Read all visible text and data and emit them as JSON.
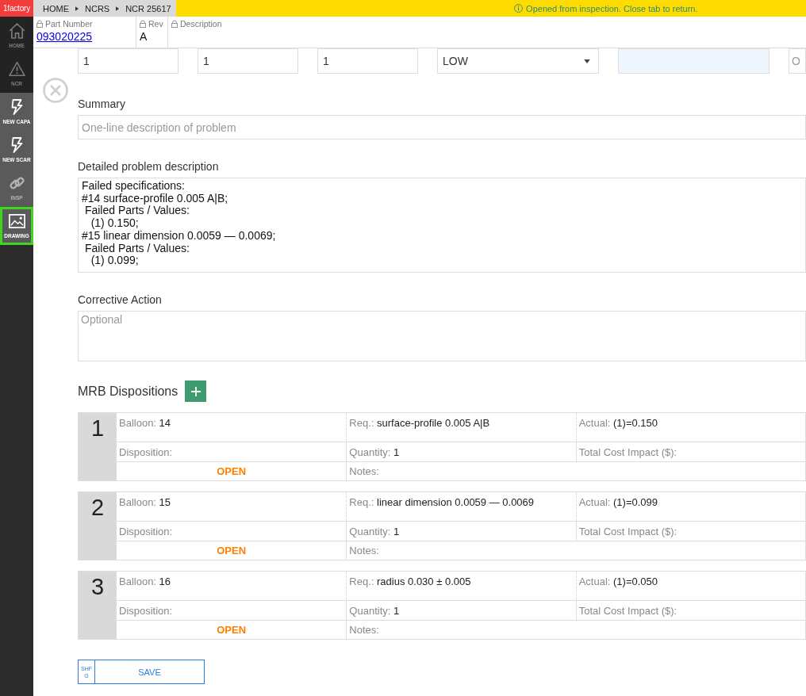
{
  "sidebar": {
    "logo": "1factory",
    "items": [
      {
        "label": "HOME",
        "kind": "nav",
        "disabled": true,
        "selected": false
      },
      {
        "label": "NCR",
        "kind": "nav",
        "disabled": true,
        "selected": false
      },
      {
        "label": "NEW CAPA",
        "kind": "action",
        "disabled": false,
        "selected": false
      },
      {
        "label": "NEW SCAR",
        "kind": "action",
        "disabled": false,
        "selected": false
      },
      {
        "label": "INSP",
        "kind": "action",
        "disabled": true,
        "selected": false
      },
      {
        "label": "DRAWING",
        "kind": "action",
        "disabled": false,
        "selected": true
      }
    ]
  },
  "breadcrumb": [
    "HOME",
    "NCRS",
    "NCR 25617"
  ],
  "notice": {
    "text": "Opened from inspection. Close tab to return."
  },
  "header_fields": [
    {
      "label": "Part Number",
      "value": "093020225",
      "kind": "link",
      "locked": true
    },
    {
      "label": "Rev",
      "value": "A",
      "kind": "text",
      "locked": true
    },
    {
      "label": "Description",
      "locked": true
    }
  ],
  "top_fields": [
    {
      "kind": "input",
      "value": "1"
    },
    {
      "kind": "input",
      "value": "1"
    },
    {
      "kind": "input",
      "value": "1"
    },
    {
      "kind": "select",
      "value": "LOW"
    },
    {
      "kind": "readonly"
    },
    {
      "kind": "input",
      "placeholder": "O"
    }
  ],
  "summary": {
    "label": "Summary",
    "placeholder": "One-line description of problem"
  },
  "problem_description": {
    "label": "Detailed problem description",
    "value": "Failed specifications:\n#14 surface-profile 0.005 A|B;\n Failed Parts / Values:\n   (1) 0.150;\n#15 linear dimension 0.0059 — 0.0069;\n Failed Parts / Values:\n   (1) 0.099;"
  },
  "corrective_action": {
    "label": "Corrective Action",
    "placeholder": "Optional"
  },
  "mrb": {
    "title": "MRB Dispositions",
    "dispositions": [
      {
        "number": "1",
        "cells": [
          {
            "label": "Balloon:",
            "value": "14"
          },
          {
            "label": "Req.:",
            "value": "surface-profile 0.005 A|B"
          },
          {
            "label": "Actual:",
            "value": "(1)=0.150"
          },
          {
            "label": "Disposition:"
          },
          {
            "label": "Quantity:",
            "value": "1"
          },
          {
            "label": "Total Cost Impact ($):"
          }
        ],
        "status": "OPEN",
        "notes_label": "Notes:"
      },
      {
        "number": "2",
        "cells": [
          {
            "label": "Balloon:",
            "value": "15"
          },
          {
            "label": "Req.:",
            "value": "linear dimension 0.0059 — 0.0069"
          },
          {
            "label": "Actual:",
            "value": "(1)=0.099"
          },
          {
            "label": "Disposition:"
          },
          {
            "label": "Quantity:",
            "value": "1"
          },
          {
            "label": "Total Cost Impact ($):"
          }
        ],
        "status": "OPEN",
        "notes_label": "Notes:"
      },
      {
        "number": "3",
        "cells": [
          {
            "label": "Balloon:",
            "value": "16"
          },
          {
            "label": "Req.:",
            "value": "radius 0.030 ± 0.005"
          },
          {
            "label": "Actual:",
            "value": "(1)=0.050"
          },
          {
            "label": "Disposition:"
          },
          {
            "label": "Quantity:",
            "value": "1"
          },
          {
            "label": "Total Cost Impact ($):"
          }
        ],
        "status": "OPEN",
        "notes_label": "Notes:"
      }
    ]
  },
  "save_button": {
    "shortcut": "SHFG",
    "label": "SAVE"
  }
}
